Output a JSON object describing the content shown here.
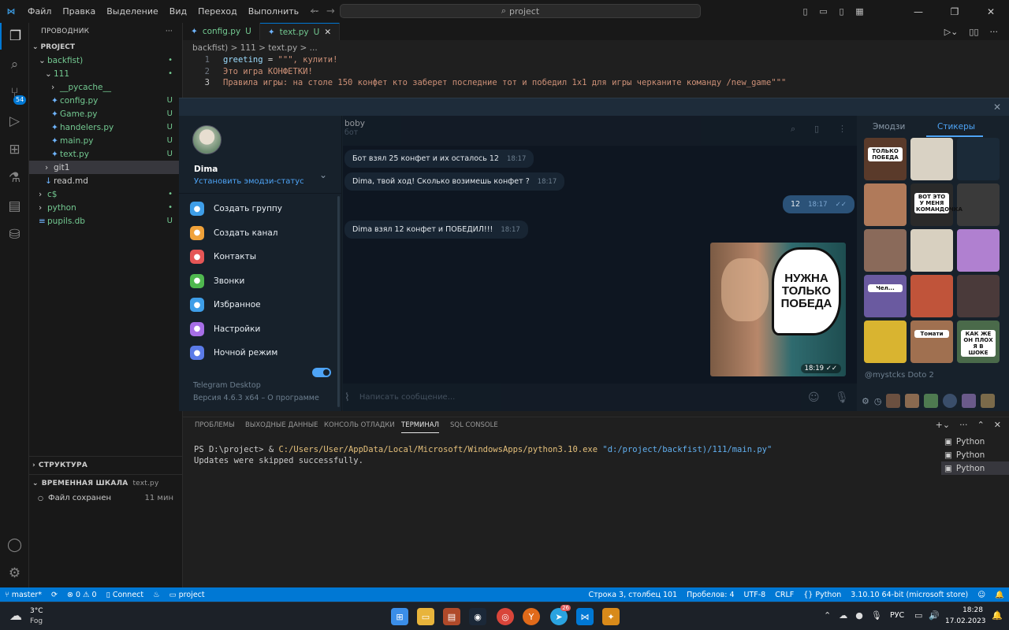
{
  "titlebar": {
    "menu": [
      "Файл",
      "Правка",
      "Выделение",
      "Вид",
      "Переход",
      "Выполнить",
      "···"
    ],
    "search": "project"
  },
  "activity": {
    "scm_badge": "54"
  },
  "sidebar": {
    "title": "ПРОВОДНИК",
    "project": "PROJECT",
    "items": [
      {
        "label": "backfist)",
        "status": "•",
        "indent": 1,
        "type": "folder-open",
        "color": "green"
      },
      {
        "label": "111",
        "status": "•",
        "indent": 2,
        "type": "folder-open",
        "color": "green"
      },
      {
        "label": "__pycache__",
        "status": "",
        "indent": 3,
        "type": "folder",
        "color": "green"
      },
      {
        "label": "config.py",
        "status": "U",
        "indent": 3,
        "type": "py",
        "color": "green"
      },
      {
        "label": "Game.py",
        "status": "U",
        "indent": 3,
        "type": "py",
        "color": "green"
      },
      {
        "label": "handelers.py",
        "status": "U",
        "indent": 3,
        "type": "py",
        "color": "green"
      },
      {
        "label": "main.py",
        "status": "U",
        "indent": 3,
        "type": "py",
        "color": "green"
      },
      {
        "label": "text.py",
        "status": "U",
        "indent": 3,
        "type": "py",
        "color": "green"
      },
      {
        "label": "git1",
        "status": "",
        "indent": 2,
        "type": "folder",
        "color": "plain"
      },
      {
        "label": "read.md",
        "status": "",
        "indent": 2,
        "type": "md",
        "color": "plain"
      },
      {
        "label": "c$",
        "status": "•",
        "indent": 1,
        "type": "folder",
        "color": "green"
      },
      {
        "label": "python",
        "status": "•",
        "indent": 1,
        "type": "folder",
        "color": "green"
      },
      {
        "label": "pupils.db",
        "status": "U",
        "indent": 1,
        "type": "db",
        "color": "green"
      }
    ],
    "structure": "СТРУКТУРА",
    "timeline": "ВРЕМЕННАЯ ШКАЛА",
    "timeline_file": "text.py",
    "timeline_entry": "Файл сохранен",
    "timeline_time": "11 мин"
  },
  "editor": {
    "tabs": [
      {
        "label": "config.py",
        "status": "U"
      },
      {
        "label": "text.py",
        "status": "U"
      }
    ],
    "breadcrumb": "backfist) > 111 > text.py > ...",
    "lines": [
      {
        "n": "1",
        "text": "greeting = \"\"\", кулити!"
      },
      {
        "n": "2",
        "text": "Это игра КОНФЕТКИ!"
      },
      {
        "n": "3",
        "text": "Правила игры: на столе 150 конфет кто заберет последние тот и победил 1х1 для игры черканите команду /new_game\"\"\""
      }
    ]
  },
  "telegram": {
    "user": "Dima",
    "status_link": "Установить эмодзи-статус",
    "menu": [
      {
        "label": "Создать группу",
        "color": "#3e9ee8",
        "icon": "group-icon"
      },
      {
        "label": "Создать канал",
        "color": "#f0a23a",
        "icon": "channel-icon"
      },
      {
        "label": "Контакты",
        "color": "#e55656",
        "icon": "contacts-icon"
      },
      {
        "label": "Звонки",
        "color": "#4fb84f",
        "icon": "calls-icon"
      },
      {
        "label": "Избранное",
        "color": "#3e9ee8",
        "icon": "saved-icon"
      },
      {
        "label": "Настройки",
        "color": "#a66ee6",
        "icon": "settings-icon"
      },
      {
        "label": "Ночной режим",
        "color": "#5b7be8",
        "icon": "moon-icon"
      }
    ],
    "app_name": "Telegram Desktop",
    "version": "Версия 4.6.3 x64 – О программе",
    "chat_name": "boby",
    "chat_sub": "бот",
    "messages": [
      {
        "text": "Бот взял 25 конфет и их осталось 12",
        "time": "18:17",
        "out": false
      },
      {
        "text": "Dima,  твой ход! Сколько возимешь конфет ?",
        "time": "18:17",
        "out": false
      },
      {
        "text": "12",
        "time": "18:17",
        "out": true
      },
      {
        "text": "Dima взял 12 конфет и ПОБЕДИЛ!!!",
        "time": "18:17",
        "out": false
      }
    ],
    "sticker_text": "НУЖНА ТОЛЬКО ПОБЕДА",
    "sticker_time": "18:19",
    "composer_placeholder": "Написать сообщение...",
    "panel_tabs": [
      "Эмодзи",
      "Стикеры"
    ],
    "pack_title": "@mystcks Doto 2",
    "sticker_captions": [
      "ТОЛЬКО ПОБЕДА",
      "ВОТ ЭТО У МЕНЯ КОМАНДОЧКА",
      "Чел...",
      "Томати",
      "КАК ЖЕ ОН ПЛОХ Я В ШОКЕ"
    ]
  },
  "bottom": {
    "tabs": [
      "ПРОБЛЕМЫ",
      "ВЫХОДНЫЕ ДАННЫЕ",
      "КОНСОЛЬ ОТЛАДКИ",
      "ТЕРМИНАЛ",
      "SQL CONSOLE"
    ],
    "term_prompt": "PS D:\\project> & ",
    "term_exe": "C:/Users/User/AppData/Local/Microsoft/WindowsApps/python3.10.exe",
    "term_arg": " \"d:/project/backfist)/111/main.py\"",
    "term_line2": "Updates were skipped successfully.",
    "terminals": [
      "Python",
      "Python",
      "Python"
    ]
  },
  "statusbar": {
    "branch": "master*",
    "problems": "⊗ 0 ⚠ 0",
    "connect": "Connect",
    "project": "project",
    "pos": "Строка 3, столбец 101",
    "spaces": "Пробелов: 4",
    "encoding": "UTF-8",
    "eol": "CRLF",
    "lang": "Python",
    "interpreter": "3.10.10 64-bit (microsoft store)"
  },
  "taskbar": {
    "temp": "3°C",
    "weather": "Fog",
    "lang": "РУС",
    "time": "18:28",
    "date": "17.02.2023",
    "tg_badge": "26"
  }
}
